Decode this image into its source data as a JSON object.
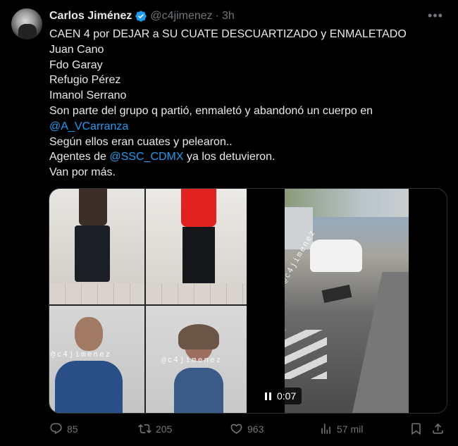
{
  "author": {
    "name": "Carlos Jiménez",
    "handle": "@c4jimenez",
    "separator": "·",
    "time": "3h"
  },
  "tweet": {
    "lines": [
      "CAEN 4 por DEJAR a SU CUATE DESCUARTIZADO y  ENMALETADO",
      "Juan Cano",
      "Fdo Garay",
      "Refugio Pérez",
      "Imanol Serrano",
      "Son parte del grupo q partió, enmaletó y abandonó un cuerpo en",
      "@A_VCarranza",
      "Según ellos eran cuates y pelearon..",
      "Agentes de ",
      "@SSC_CDMX",
      " ya los detuvieron.",
      "Van por más."
    ]
  },
  "media": {
    "watermark_photo_left": "@c4jimenez",
    "watermark_photo_right": "@c4jimenez",
    "watermark_video": "@c4jimenez",
    "video_time": "0:07"
  },
  "actions": {
    "replies": "85",
    "reposts": "205",
    "likes": "963",
    "views": "57 mil"
  },
  "icons": [
    "verified-badge-icon",
    "more-icon",
    "reply-icon",
    "repost-icon",
    "like-icon",
    "views-icon",
    "bookmark-icon",
    "share-icon",
    "pause-icon"
  ],
  "colors": {
    "background": "#000000",
    "text": "#e7e9ea",
    "muted": "#71767b",
    "accent": "#1d9bf0"
  }
}
